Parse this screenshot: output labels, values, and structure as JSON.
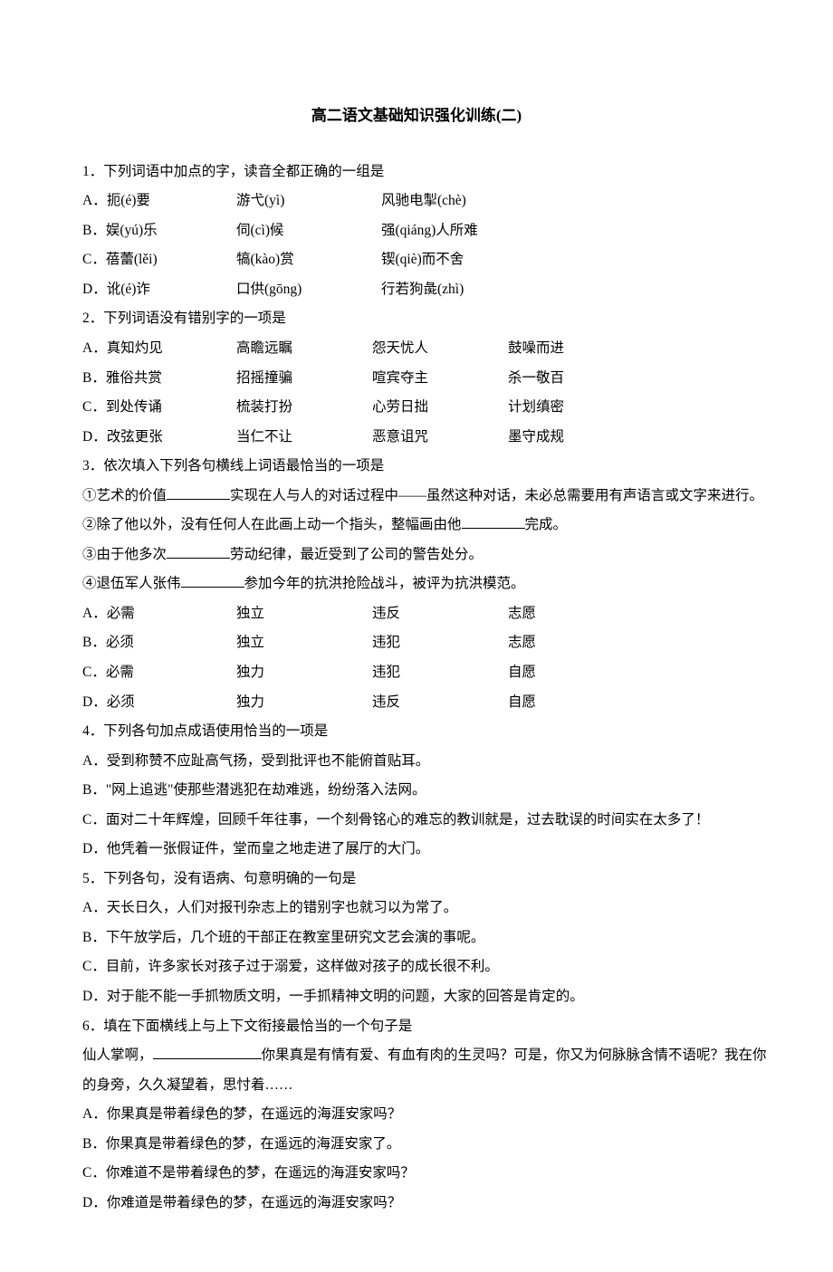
{
  "title": "高二语文基础知识强化训练(二)",
  "q1": {
    "stem": "1．下列词语中加点的字，读音全都正确的一组是",
    "a": [
      "A．扼(é)要",
      "游弋(yì)",
      "风驰电掣(chè)"
    ],
    "b": [
      "B．娱(yú)乐",
      "伺(cì)候",
      "强(qiáng)人所难"
    ],
    "c": [
      "C．蓓蕾(lěi)",
      "犒(kào)赏",
      "锲(qiè)而不舍"
    ],
    "d": [
      "D．讹(é)诈",
      "口供(gōng)",
      "行若狗彘(zhì)"
    ]
  },
  "q2": {
    "stem": "2．下列词语没有错别字的一项是",
    "a": [
      "A．真知灼见",
      "高瞻远瞩",
      "怨天忧人",
      "鼓噪而进"
    ],
    "b": [
      "B．雅俗共赏",
      "招摇撞骗",
      "喧宾夺主",
      "杀一敬百"
    ],
    "c": [
      "C．到处传诵",
      "梳装打扮",
      "心劳日拙",
      "计划缜密"
    ],
    "d": [
      "D．改弦更张",
      "当仁不让",
      "恶意诅咒",
      "墨守成规"
    ]
  },
  "q3": {
    "stem": "3．依次填入下列各句横线上词语最恰当的一项是",
    "s1a": "①艺术的价值",
    "s1b": "实现在人与人的对话过程中——虽然这种对话，未必总需要用有声语言或文字来进行。",
    "s2a": "②除了他以外，没有任何人在此画上动一个指头，整幅画由他",
    "s2b": "完成。",
    "s3a": "③由于他多次",
    "s3b": "劳动纪律，最近受到了公司的警告处分。",
    "s4a": "④退伍军人张伟",
    "s4b": "参加今年的抗洪抢险战斗，被评为抗洪模范。",
    "a": [
      "A．必需",
      "独立",
      "违反",
      "志愿"
    ],
    "b": [
      "B．必须",
      "独立",
      "违犯",
      "志愿"
    ],
    "c": [
      "C．必需",
      "独力",
      "违犯",
      "自愿"
    ],
    "d": [
      "D．必须",
      "独力",
      "违反",
      "自愿"
    ]
  },
  "q4": {
    "stem": "4．下列各句加点成语使用恰当的一项是",
    "a": "A．受到称赞不应趾高气扬，受到批评也不能俯首贴耳。",
    "b": "B．\"网上追逃\"使那些潜逃犯在劫难逃，纷纷落入法网。",
    "c": "C．面对二十年辉煌，回顾千年往事，一个刻骨铭心的难忘的教训就是，过去耽误的时间实在太多了！",
    "d": "D．他凭着一张假证件，堂而皇之地走进了展厅的大门。"
  },
  "q5": {
    "stem": "5．下列各句，没有语病、句意明确的一句是",
    "a": "A．天长日久，人们对报刊杂志上的错别字也就习以为常了。",
    "b": "B．下午放学后，几个班的干部正在教室里研究文艺会演的事呢。",
    "c": "C．目前，许多家长对孩子过于溺爱，这样做对孩子的成长很不利。",
    "d": "D．对于能不能一手抓物质文明，一手抓精神文明的问题，大家的回答是肯定的。"
  },
  "q6": {
    "stem": "6．填在下面横线上与上下文衔接最恰当的一个句子是",
    "ctx1": "仙人掌啊，",
    "ctx2": "你果真是有情有爱、有血有肉的生灵吗？可是，你又为何脉脉含情不语呢？我在你的身旁，久久凝望着，思忖着……",
    "a": "A．你果真是带着绿色的梦，在遥远的海涯安家吗？",
    "b": "B．你果真是带着绿色的梦，在遥远的海涯安家了。",
    "c": "C．你难道不是带着绿色的梦，在遥远的海涯安家吗？",
    "d": "D．你难道是带着绿色的梦，在遥远的海涯安家吗？"
  }
}
